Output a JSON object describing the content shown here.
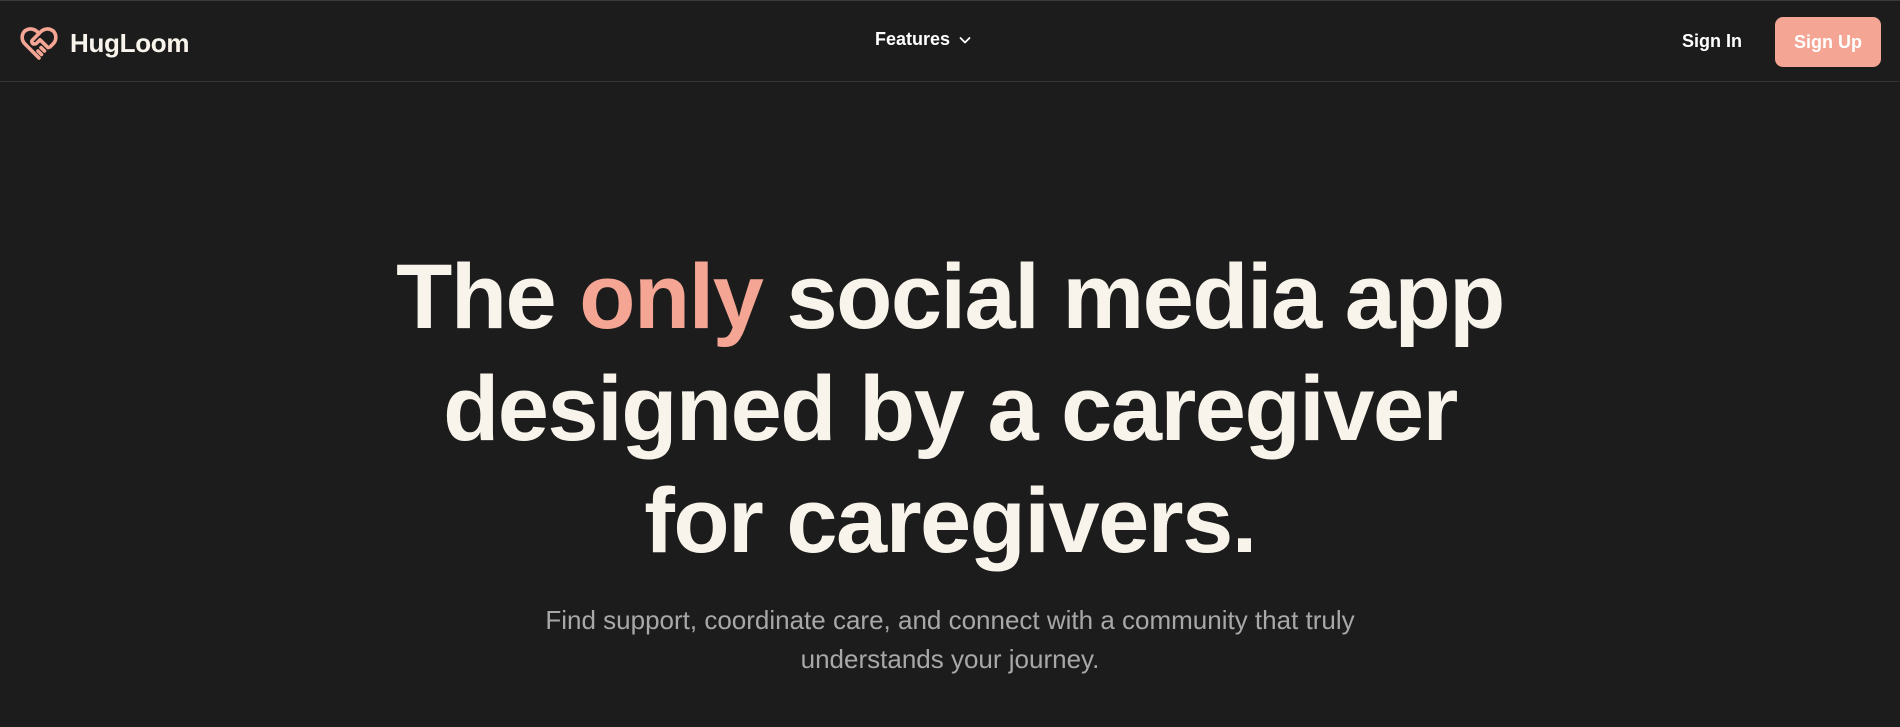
{
  "colors": {
    "background": "#1c1c1c",
    "headline": "#f8f4ec",
    "accent": "#f4a593",
    "subtitle": "#a8a8a8",
    "signup_bg": "#f4a593"
  },
  "header": {
    "brand_name": "HugLoom",
    "brand_icon": "heart-handshake-icon",
    "nav": {
      "features_label": "Features",
      "features_icon": "chevron-down-icon"
    },
    "signin_label": "Sign In",
    "signup_label": "Sign Up"
  },
  "hero": {
    "headline": {
      "line1_before": "The",
      "line1_accent": "only",
      "line1_after": "social media app",
      "line2": "designed by a caregiver",
      "line3": "for caregivers."
    },
    "subtitle_line1": "Find support, coordinate care, and connect with a community that truly",
    "subtitle_line2": "understands your journey."
  }
}
